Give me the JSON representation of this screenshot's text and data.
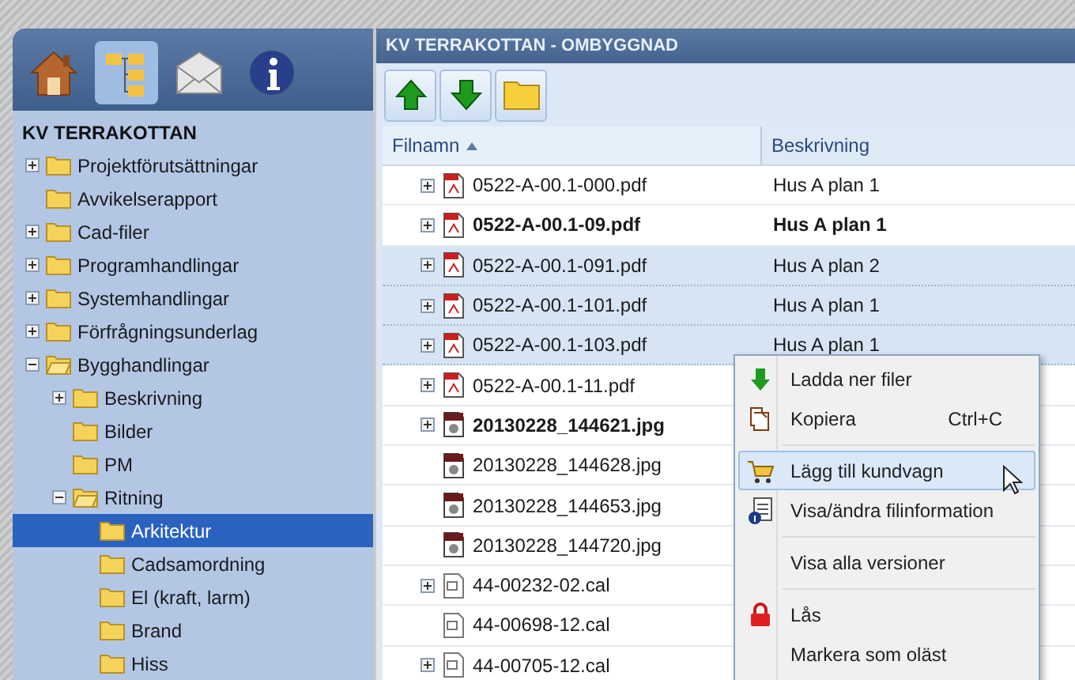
{
  "nav_tabs": [
    {
      "kind": "home",
      "selected": false
    },
    {
      "kind": "tree",
      "selected": true
    },
    {
      "kind": "mail",
      "selected": false
    },
    {
      "kind": "info",
      "selected": false
    }
  ],
  "tree": {
    "title": "KV TERRAKOTTAN",
    "items": [
      {
        "label": "Projektförutsättningar",
        "expandable": true,
        "expanded": false,
        "selected": false
      },
      {
        "label": "Avvikelserapport",
        "expandable": false,
        "selected": false
      },
      {
        "label": "Cad-filer",
        "expandable": true,
        "expanded": false,
        "selected": false
      },
      {
        "label": "Programhandlingar",
        "expandable": true,
        "expanded": false,
        "selected": false
      },
      {
        "label": "Systemhandlingar",
        "expandable": true,
        "expanded": false,
        "selected": false
      },
      {
        "label": "Förfrågningsunderlag",
        "expandable": true,
        "expanded": false,
        "selected": false
      },
      {
        "label": "Bygghandlingar",
        "expandable": true,
        "expanded": true,
        "selected": false,
        "children": [
          {
            "label": "Beskrivning",
            "expandable": true,
            "expanded": false,
            "selected": false
          },
          {
            "label": "Bilder",
            "expandable": false,
            "selected": false
          },
          {
            "label": "PM",
            "expandable": false,
            "selected": false
          },
          {
            "label": "Ritning",
            "expandable": true,
            "expanded": true,
            "selected": false,
            "children": [
              {
                "label": "Arkitektur",
                "expandable": false,
                "selected": true
              },
              {
                "label": "Cadsamordning",
                "expandable": false,
                "selected": false
              },
              {
                "label": "El (kraft, larm)",
                "expandable": false,
                "selected": false
              },
              {
                "label": "Brand",
                "expandable": false,
                "selected": false
              },
              {
                "label": "Hiss",
                "expandable": false,
                "selected": false
              }
            ]
          }
        ]
      }
    ]
  },
  "panel_title": "KV TERRAKOTTAN - OMBYGGNAD",
  "toolbar": [
    {
      "kind": "up"
    },
    {
      "kind": "down"
    },
    {
      "kind": "folder"
    }
  ],
  "table": {
    "columns": [
      {
        "label": "Filnamn",
        "sorted": true
      },
      {
        "label": "Beskrivning",
        "sorted": false
      }
    ],
    "rows": [
      {
        "kind": "pdf",
        "name": "0522-A-00.1-000.pdf",
        "description": "Hus A plan 1",
        "expandable": true,
        "bold": false,
        "selected": false
      },
      {
        "kind": "pdf",
        "name": "0522-A-00.1-09.pdf",
        "description": "Hus A plan 1",
        "expandable": true,
        "bold": true,
        "selected": false
      },
      {
        "kind": "pdf",
        "name": "0522-A-00.1-091.pdf",
        "description": "Hus A plan 2",
        "expandable": true,
        "bold": false,
        "selected": true
      },
      {
        "kind": "pdf",
        "name": "0522-A-00.1-101.pdf",
        "description": "Hus A plan 1",
        "expandable": true,
        "bold": false,
        "selected": true
      },
      {
        "kind": "pdf",
        "name": "0522-A-00.1-103.pdf",
        "description": "Hus A plan 1",
        "expandable": true,
        "bold": false,
        "selected": true
      },
      {
        "kind": "pdf",
        "name": "0522-A-00.1-11.pdf",
        "expandable": true,
        "bold": false,
        "selected": false
      },
      {
        "kind": "jpg",
        "name": "20130228_144621.jpg",
        "expandable": true,
        "bold": true,
        "selected": false
      },
      {
        "kind": "jpg",
        "name": "20130228_144628.jpg",
        "expandable": false,
        "bold": false,
        "selected": false
      },
      {
        "kind": "jpg",
        "name": "20130228_144653.jpg",
        "expandable": false,
        "bold": false,
        "selected": false
      },
      {
        "kind": "jpg",
        "name": "20130228_144720.jpg",
        "expandable": false,
        "bold": false,
        "selected": false
      },
      {
        "kind": "cal",
        "name": "44-00232-02.cal",
        "expandable": true,
        "bold": false,
        "selected": false
      },
      {
        "kind": "cal",
        "name": "44-00698-12.cal",
        "expandable": false,
        "bold": false,
        "selected": false
      },
      {
        "kind": "cal",
        "name": "44-00705-12.cal",
        "expandable": true,
        "bold": false,
        "selected": false
      }
    ]
  },
  "context_menu": [
    {
      "kind": "download",
      "label": "Ladda ner filer",
      "highlighted": false,
      "separator_before": false
    },
    {
      "kind": "copy",
      "label": "Kopiera",
      "shortcut": "Ctrl+C",
      "highlighted": false,
      "separator_before": false
    },
    {
      "kind": "cart",
      "label": "Lägg till kundvagn",
      "highlighted": true,
      "separator_before": true
    },
    {
      "kind": "fileinfo",
      "label": "Visa/ändra filinformation",
      "highlighted": false,
      "separator_before": false
    },
    {
      "kind": "none",
      "label": "Visa alla versioner",
      "highlighted": false,
      "separator_before": true
    },
    {
      "kind": "lock",
      "label": "Lås",
      "highlighted": false,
      "separator_before": true
    },
    {
      "kind": "none",
      "label": "Markera som oläst",
      "highlighted": false,
      "separator_before": false
    }
  ]
}
